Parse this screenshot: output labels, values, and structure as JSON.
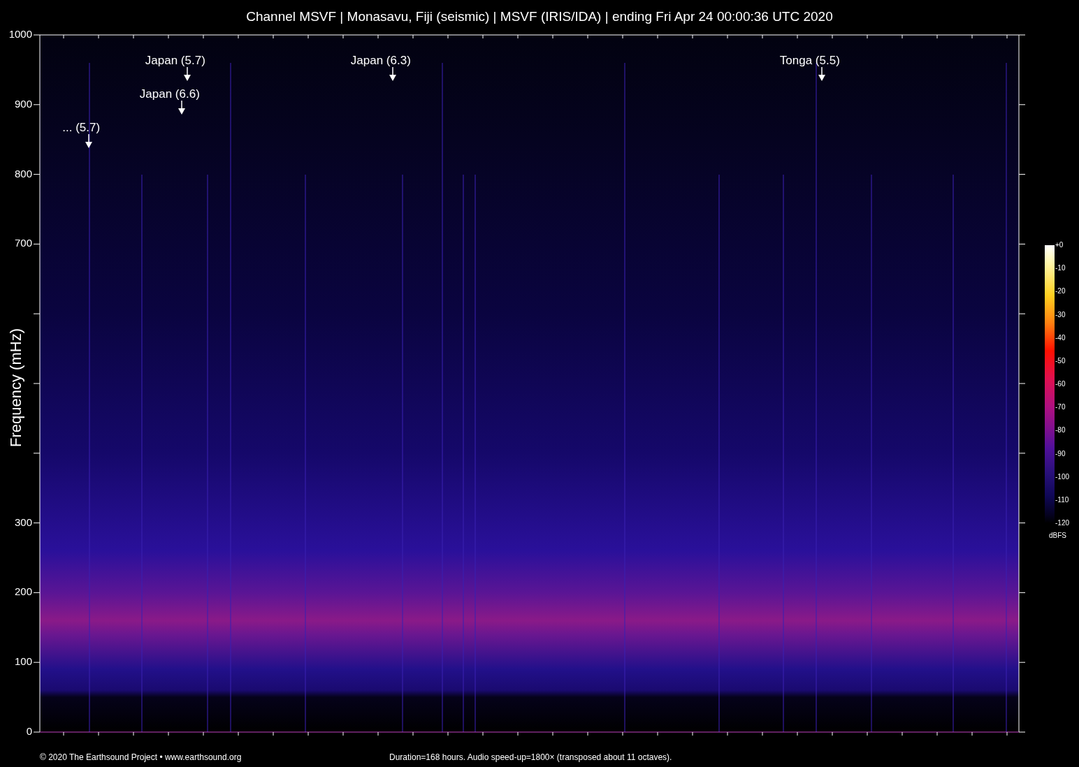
{
  "title": "Channel MSVF | Monasavu, Fiji (seismic) | MSVF (IRIS/IDA) | ending Fri Apr 24 00:00:36 UTC 2020",
  "y_axis": {
    "label": "Frequency (mHz)",
    "ticks": [
      {
        "kind": "major",
        "label": "1000"
      },
      {
        "kind": "major",
        "label": "900"
      },
      {
        "kind": "major",
        "label": "800"
      },
      {
        "kind": "major",
        "label": "700"
      },
      {
        "kind": "minor"
      },
      {
        "kind": "minor"
      },
      {
        "kind": "minor"
      },
      {
        "kind": "major",
        "label": "300"
      },
      {
        "kind": "major",
        "label": "200"
      },
      {
        "kind": "major",
        "label": "100"
      },
      {
        "kind": "major",
        "label": "0"
      }
    ]
  },
  "annotations": [
    {
      "label": "... (5.7)"
    },
    {
      "label": "Japan (5.7)"
    },
    {
      "label": "Japan (6.6)"
    },
    {
      "label": "Japan (6.3)"
    },
    {
      "label": "Tonga (5.5)"
    }
  ],
  "colorbar": {
    "ticks": [
      "+0",
      "-10",
      "-20",
      "-30",
      "-40",
      "-50",
      "-60",
      "-70",
      "-80",
      "-90",
      "-100",
      "-110",
      "-120"
    ],
    "unit": "dBFS"
  },
  "footer": {
    "credit": "© 2020 The Earthsound Project • www.earthsound.org",
    "note": "Duration=168 hours. Audio speed-up=1800× (transposed about 11 octaves)."
  }
}
